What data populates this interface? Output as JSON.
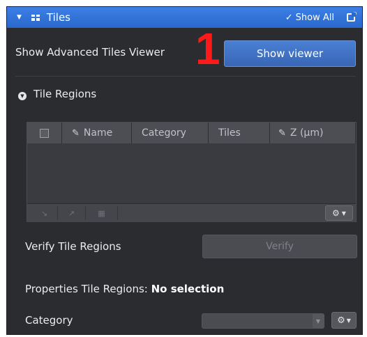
{
  "header": {
    "title": "Tiles",
    "show_all_check": "✓",
    "show_all_label": "Show All"
  },
  "advanced": {
    "label": "Show Advanced Tiles Viewer",
    "button": "Show viewer",
    "annotation": "1"
  },
  "regions": {
    "title": "Tile Regions",
    "columns": [
      "Name",
      "Category",
      "Tiles",
      "Z (µm)"
    ]
  },
  "verify": {
    "label": "Verify Tile Regions",
    "button": "Verify"
  },
  "properties": {
    "label": "Properties Tile Regions:",
    "value": "No selection"
  },
  "category": {
    "label": "Category",
    "value": ""
  },
  "icons": {
    "collapse": "triangle-down",
    "tiles": "grid",
    "pen": "pencil",
    "gear": "gear",
    "popout": "external-window"
  },
  "colors": {
    "header": "#2f6fd6",
    "panel": "#2b2c30",
    "primary_button": "#4372c4",
    "annotation": "#ff1a1a"
  }
}
